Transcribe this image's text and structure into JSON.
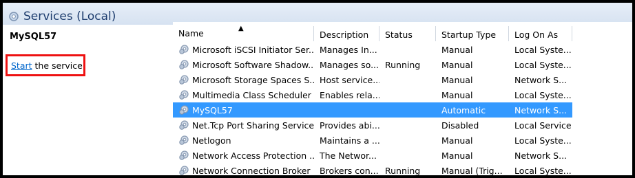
{
  "window": {
    "title": "Services (Local)"
  },
  "left_panel": {
    "service_name": "MySQL57",
    "action_link": "Start",
    "action_text": " the service"
  },
  "columns": [
    "Name",
    "Description",
    "Status",
    "Startup Type",
    "Log On As"
  ],
  "rows": [
    {
      "name": "Microsoft iSCSI Initiator Ser...",
      "desc": "Manages In...",
      "status": "",
      "startup": "Manual",
      "logon": "Local Syste..."
    },
    {
      "name": "Microsoft Software Shadow...",
      "desc": "Manages so...",
      "status": "Running",
      "startup": "Manual",
      "logon": "Local Syste..."
    },
    {
      "name": "Microsoft Storage Spaces S...",
      "desc": "Host service...",
      "status": "",
      "startup": "Manual",
      "logon": "Network S..."
    },
    {
      "name": "Multimedia Class Scheduler",
      "desc": "Enables rela...",
      "status": "",
      "startup": "Manual",
      "logon": "Local Syste..."
    },
    {
      "name": "MySQL57",
      "desc": "",
      "status": "",
      "startup": "Automatic",
      "logon": "Network S...",
      "selected": true
    },
    {
      "name": "Net.Tcp Port Sharing Service",
      "desc": "Provides abi...",
      "status": "",
      "startup": "Disabled",
      "logon": "Local Service"
    },
    {
      "name": "Netlogon",
      "desc": "Maintains a ...",
      "status": "",
      "startup": "Manual",
      "logon": "Local Syste..."
    },
    {
      "name": "Network Access Protection ...",
      "desc": "The Networ...",
      "status": "",
      "startup": "Manual",
      "logon": "Network S..."
    },
    {
      "name": "Network Connection Broker",
      "desc": "Brokers con...",
      "status": "Running",
      "startup": "Manual (Trig...",
      "logon": "Local Syste..."
    }
  ],
  "colors": {
    "selection": "#3399ff",
    "highlight_box": "#ee1111",
    "link": "#0066cc",
    "header_title": "#1e3d6e"
  },
  "icons": {
    "title": "services-gear-icon",
    "row": "service-gear-icon",
    "sort": "sort-ascending-icon"
  }
}
